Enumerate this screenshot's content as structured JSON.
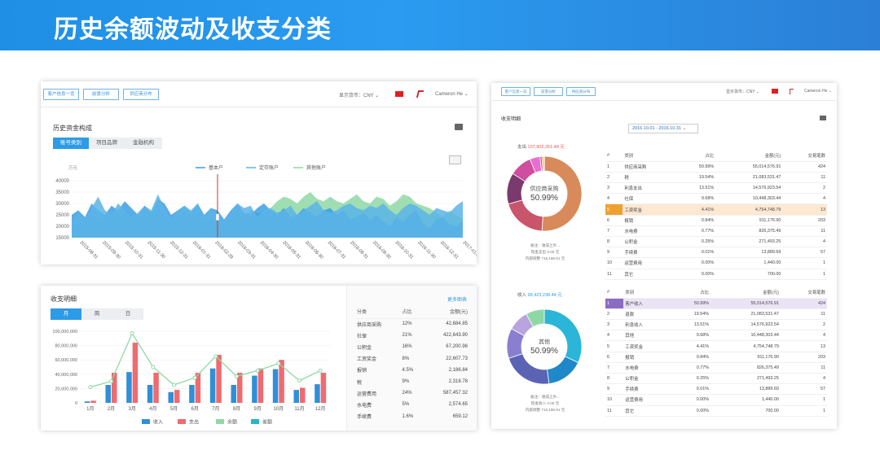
{
  "banner": {
    "title": "历史余额波动及收支分类"
  },
  "left_top": {
    "nav_buttons": [
      "客户信息一览",
      "前景分析",
      "供应商分布"
    ],
    "currency_label": "显示货币：CNY",
    "user_name": "Cameron He",
    "panel_title": "历史资金构成",
    "tabs": [
      "账号类别",
      "项目品牌",
      "金融机构"
    ],
    "active_tab": 0,
    "unit_label": "万元",
    "chart_data": {
      "type": "area",
      "title": "历史资金构成",
      "ylabel": "万元",
      "ylim": [
        15000,
        40000
      ],
      "yticks": [
        15000,
        20000,
        25000,
        30000,
        35000,
        40000
      ],
      "x_ticks": [
        "2015-08-31",
        "2015-09-30",
        "2015-10-31",
        "2015-11-30",
        "2015-12-31",
        "2016-01-31",
        "2016-02-29",
        "2016-03-31",
        "2016-04-30",
        "2016-05-31",
        "2016-06-30",
        "2016-07-31",
        "2016-08-31",
        "2016-09-30",
        "2016-10-31",
        "2016-11-30",
        "2016-12-31",
        "2017-01-31"
      ],
      "legend": [
        "基本户",
        "定存账户",
        "其他账户"
      ],
      "legend_position": "top",
      "series": [
        {
          "name": "基本户",
          "color": "#3a9ee6",
          "values": [
            25000,
            27000,
            24000,
            30000,
            27000,
            25000,
            29000,
            27000,
            31000,
            28000,
            25000,
            29000,
            26000,
            32000,
            30000,
            25000,
            27000,
            29000,
            26000,
            30000,
            25000,
            28000,
            27000,
            23000,
            27000,
            30000,
            26000,
            25000,
            28000,
            30000,
            27000,
            25000,
            28000,
            24000,
            25000,
            28000,
            26000,
            24000,
            27000,
            28000,
            25000,
            27000,
            23000,
            24000,
            26000,
            23000,
            25000,
            22000,
            20000,
            24000,
            22000,
            25000,
            27000,
            21000,
            19000,
            23000,
            24000,
            21000,
            20000,
            22000
          ]
        },
        {
          "name": "定存账户",
          "color": "#5ab4e8",
          "values": [
            22000,
            26000,
            23000,
            28000,
            33000,
            27000,
            25000,
            30000,
            27000,
            24000,
            26000,
            29000,
            27000,
            34000,
            28000,
            23000,
            27000,
            29000,
            27000,
            30000,
            24000,
            28000,
            26000,
            22000,
            26000,
            30000,
            28000,
            29000,
            24000,
            27000,
            28000,
            26000,
            27000,
            29000,
            25000,
            27000,
            29000,
            31000,
            27000,
            26000,
            27000,
            29000,
            30000,
            28000,
            27000,
            29000,
            28000,
            30000,
            27000,
            25000,
            28000,
            30000,
            29000,
            27000,
            25000,
            28000,
            27000,
            26000,
            29000,
            31000
          ]
        },
        {
          "name": "其他账户",
          "color": "#8ed8a6",
          "values": [
            20000,
            22000,
            21000,
            24000,
            23000,
            22000,
            25000,
            24000,
            26000,
            23000,
            22000,
            27000,
            25000,
            28000,
            24000,
            22000,
            24000,
            26000,
            23000,
            25000,
            22000,
            24000,
            23000,
            21000,
            24000,
            27000,
            25000,
            27000,
            26000,
            25000,
            28000,
            31000,
            33000,
            32000,
            30000,
            33000,
            35000,
            32000,
            31000,
            33000,
            31000,
            30000,
            32000,
            34000,
            31000,
            30000,
            33000,
            32000,
            29000,
            31000,
            34000,
            33000,
            30000,
            29000,
            28000,
            26000,
            24000,
            27000,
            25000,
            23000
          ]
        }
      ],
      "marker_index": 22
    }
  },
  "left_bottom": {
    "panel_title": "收支明细",
    "more_link": "更多图表",
    "tabs": [
      "月",
      "周",
      "日"
    ],
    "active_tab": 0,
    "chart_data": {
      "type": "bar",
      "categories": [
        "1月",
        "2月",
        "3月",
        "4月",
        "5月",
        "6月",
        "7月",
        "8月",
        "9月",
        "10月",
        "11月",
        "12月"
      ],
      "ylim": [
        0,
        100000000
      ],
      "yticks": [
        "0",
        "20,000,000",
        "40,000,000",
        "60,000,000",
        "80,000,000",
        "100,000,000"
      ],
      "series": [
        {
          "name": "收入",
          "color": "#2f8fd8",
          "type": "bar",
          "values": [
            2000000,
            25000000,
            43000000,
            25000000,
            15000000,
            25000000,
            48000000,
            25000000,
            38000000,
            47000000,
            18000000,
            26000000
          ]
        },
        {
          "name": "支出",
          "color": "#ee6b6f",
          "type": "bar",
          "values": [
            3000000,
            42000000,
            84000000,
            42000000,
            18000000,
            42000000,
            67000000,
            42000000,
            48000000,
            60000000,
            21000000,
            42000000
          ]
        },
        {
          "name": "余额",
          "color": "#8ed8a6",
          "type": "line",
          "values": [
            22000000,
            30000000,
            97000000,
            50000000,
            25000000,
            35000000,
            65000000,
            37000000,
            45000000,
            55000000,
            31000000,
            45000000
          ]
        },
        {
          "name": "差额",
          "color": "#2bb5c8",
          "type": "none",
          "values": []
        }
      ],
      "legend": [
        "收入",
        "支出",
        "余额",
        "差额"
      ],
      "legend_position": "bottom"
    },
    "table": {
      "headers": [
        "分类",
        "占比",
        "金额(元)"
      ],
      "rows": [
        [
          "供应商采购",
          "12%",
          "42,684.85"
        ],
        [
          "社保",
          "21%",
          "422,643.90"
        ],
        [
          "公积金",
          "16%",
          "67,200.96"
        ],
        [
          "工资奖金",
          "8%",
          "22,607.73"
        ],
        [
          "报销",
          "4.5%",
          "2,186.84"
        ],
        [
          "税",
          "9%",
          "2,318.78"
        ],
        [
          "运营费用",
          "24%",
          "587,457.32"
        ],
        [
          "水电费",
          "5%",
          "2,574.65"
        ],
        [
          "手续费",
          "1.6%",
          "659.12"
        ]
      ]
    }
  },
  "right": {
    "nav_buttons": [
      "客户信息一览",
      "前景分析",
      "供应商分布"
    ],
    "currency_label": "显示货币：CNY",
    "user_name": "Cameron He",
    "panel_title": "收支明细",
    "date_range": "2016.10.01 - 2016.10.31",
    "expense": {
      "label_prefix": "支出",
      "amount": "107,902,251.48 元",
      "donut_label": "供应商采购",
      "donut_percent": "50.99%",
      "notes": [
        "备注：驰成之外...",
        "现金支出 0.00 元",
        "内部调整 715,198.91 元"
      ],
      "chart_data": {
        "type": "pie",
        "values": [
          50.99,
          19.54,
          13.51,
          9.68,
          4.41,
          0.84,
          0.77,
          0.25
        ],
        "colors": [
          "#d98a5a",
          "#c9556a",
          "#7b3a6e",
          "#d04ea0",
          "#e86fd0",
          "#b05ac8",
          "#e8a837",
          "#f0c64a"
        ]
      },
      "table": {
        "headers": [
          "#",
          "类别",
          "占比",
          "金额(元)",
          "交易笔数"
        ],
        "rows": [
          [
            "1",
            "供应商采购",
            "50.99%",
            "55,014,576.91",
            "424"
          ],
          [
            "2",
            "税",
            "19.54%",
            "21,083,531.47",
            "11"
          ],
          [
            "3",
            "利息支出",
            "13.51%",
            "14,576,923.54",
            "2"
          ],
          [
            "4",
            "社保",
            "9.68%",
            "10,448,303.44",
            "4"
          ],
          [
            "5",
            "工资奖金",
            "4.41%",
            "4,754,748.79",
            "13"
          ],
          [
            "6",
            "报销",
            "0.84%",
            "911,176.90",
            "203"
          ],
          [
            "7",
            "水电费",
            "0.77%",
            "826,375.49",
            "11"
          ],
          [
            "8",
            "公积金",
            "0.25%",
            "271,493.25",
            "4"
          ],
          [
            "9",
            "手续费",
            "0.01%",
            "13,889.69",
            "57"
          ],
          [
            "10",
            "运营费用",
            "0.00%",
            "1,440.00",
            "1"
          ],
          [
            "11",
            "其它",
            "0.00%",
            "700.00",
            "1"
          ]
        ],
        "highlight_row": 4
      }
    },
    "income": {
      "label_prefix": "收入",
      "amount": "98,423,238.44 元",
      "donut_label": "其他",
      "donut_percent": "50.99%",
      "notes": [
        "备注：驰成之外...",
        "现金收入 0.00 元",
        "内部调整 715,198.91 元"
      ],
      "chart_data": {
        "type": "pie",
        "values": [
          32,
          16,
          22,
          13,
          9,
          8
        ],
        "colors": [
          "#2bb5d8",
          "#1e88c8",
          "#5b63b5",
          "#8a7ed0",
          "#b9a3e0",
          "#8ed8a6"
        ]
      },
      "table": {
        "headers": [
          "#",
          "类别",
          "占比",
          "金额(元)",
          "交易笔数"
        ],
        "rows": [
          [
            "1",
            "客户收入",
            "50.99%",
            "55,014,576.91",
            "424"
          ],
          [
            "2",
            "退款",
            "19.54%",
            "21,083,531.47",
            "11"
          ],
          [
            "3",
            "利息收入",
            "13.51%",
            "14,576,923.54",
            "2"
          ],
          [
            "4",
            "其他",
            "9.68%",
            "10,448,303.44",
            "4"
          ],
          [
            "5",
            "工资奖金",
            "4.41%",
            "4,754,748.79",
            "13"
          ],
          [
            "6",
            "报销",
            "0.84%",
            "911,176.90",
            "203"
          ],
          [
            "7",
            "水电费",
            "0.77%",
            "826,375.49",
            "11"
          ],
          [
            "8",
            "公积金",
            "0.25%",
            "271,493.25",
            "4"
          ],
          [
            "9",
            "手续费",
            "0.01%",
            "13,889.69",
            "57"
          ],
          [
            "10",
            "运营费用",
            "0.00%",
            "1,440.00",
            "1"
          ],
          [
            "11",
            "其它",
            "0.00%",
            "700.00",
            "1"
          ]
        ],
        "highlight_row": 0
      }
    }
  }
}
